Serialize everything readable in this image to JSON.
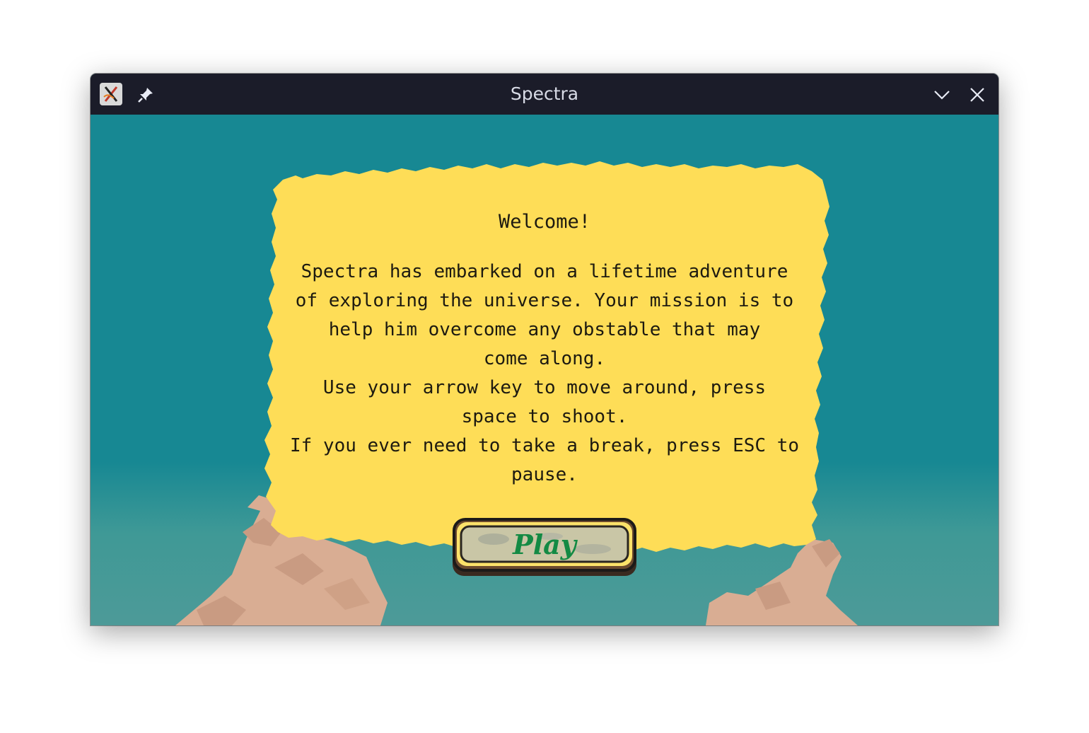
{
  "window": {
    "title": "Spectra",
    "icons": [
      "app-icon",
      "pin-icon",
      "minimize-icon",
      "close-icon"
    ]
  },
  "dialog": {
    "heading": "Welcome!",
    "body": "Spectra has embarked on a lifetime adventure\nof exploring the universe. Your mission is to\nhelp him overcome any obstable that may\ncome along.\nUse your arrow key to move around, press\nspace to shoot.\nIf you ever need to take a break, press ESC to\npause.",
    "play_label": "Play"
  },
  "colors": {
    "sky": "#178893",
    "parchment": "#fedd57",
    "rocks": "#d9ad93",
    "titlebar": "#1b1c29",
    "play_text": "#138a44"
  }
}
